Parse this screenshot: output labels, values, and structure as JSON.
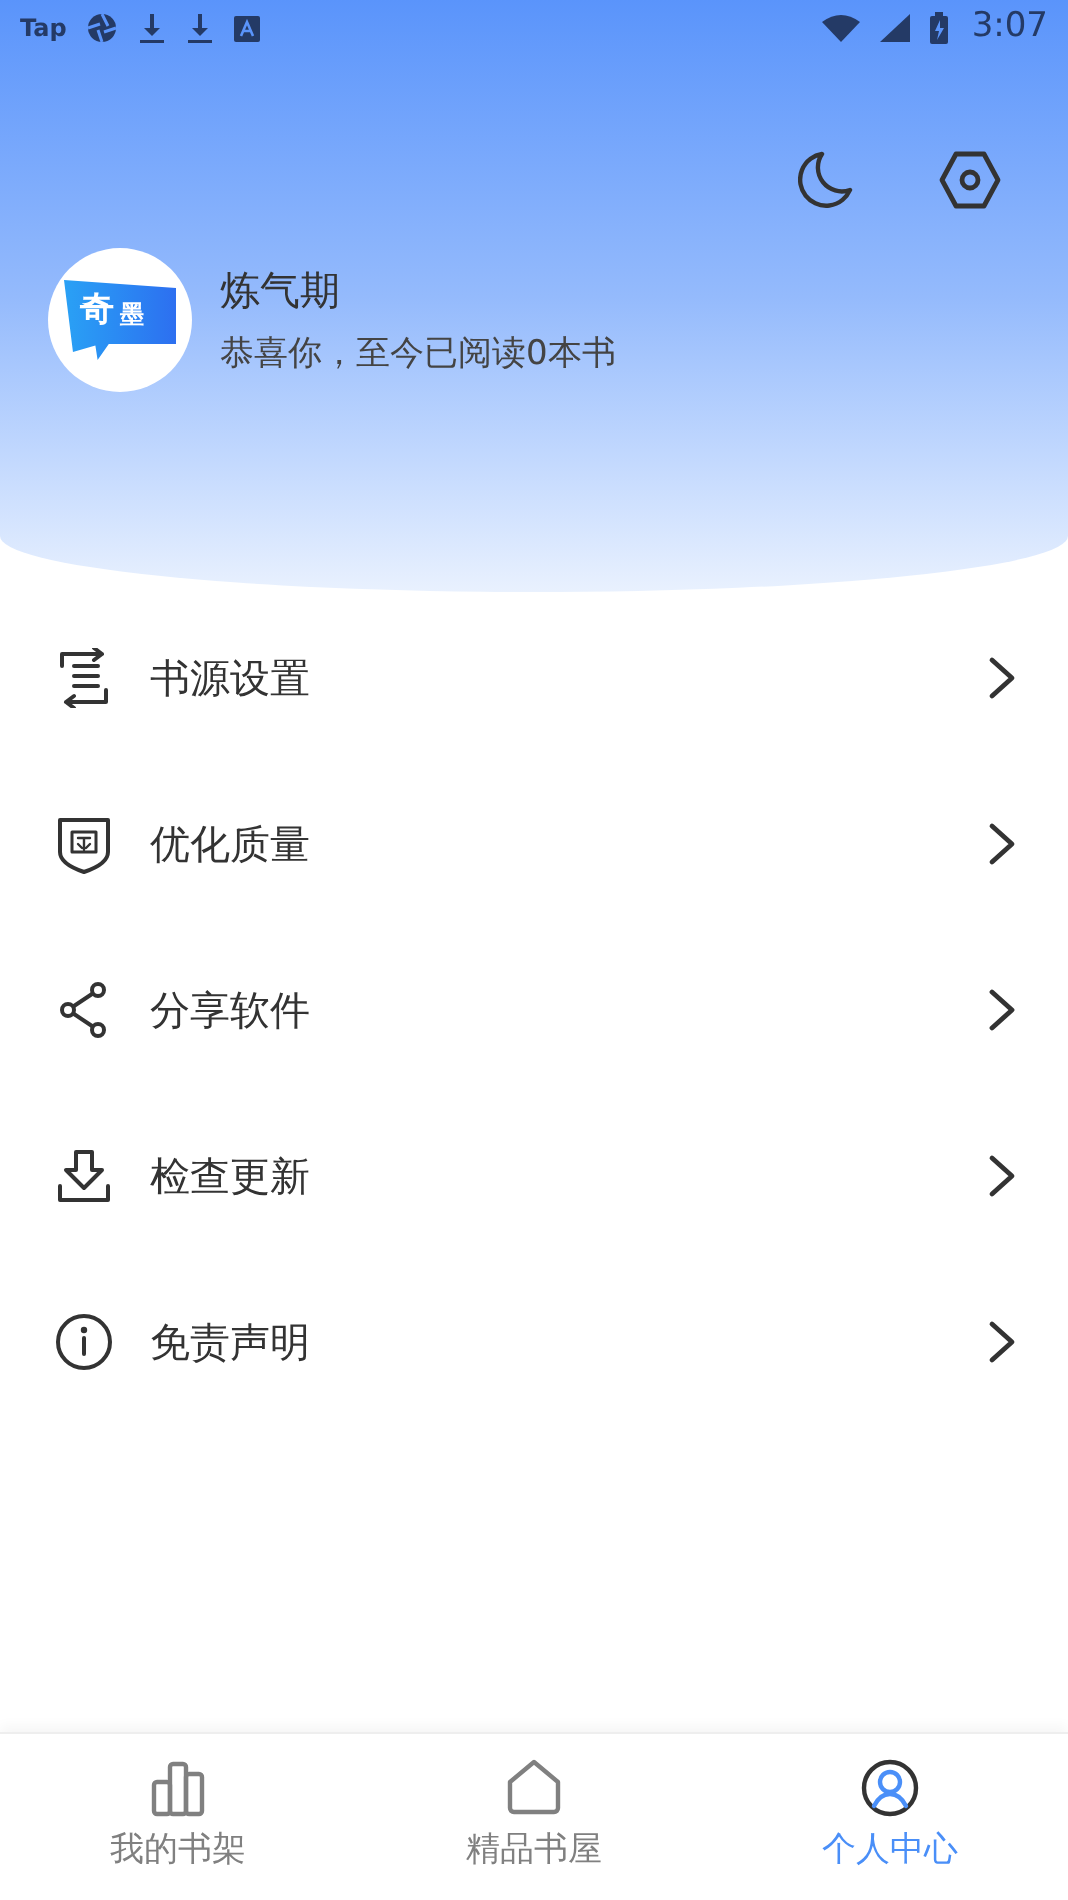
{
  "status_bar": {
    "app_label": "Tap",
    "time": "3:07"
  },
  "profile": {
    "logo_text": [
      "奇",
      "墨"
    ],
    "name": "炼气期",
    "subtitle": "恭喜你，至今已阅读0本书"
  },
  "menu": [
    {
      "kind": "source",
      "label": "书源设置"
    },
    {
      "kind": "quality",
      "label": "优化质量"
    },
    {
      "kind": "share",
      "label": "分享软件"
    },
    {
      "kind": "update",
      "label": "检查更新"
    },
    {
      "kind": "info",
      "label": "免责声明"
    }
  ],
  "nav": [
    {
      "kind": "shelf",
      "label": "我的书架",
      "selected": false
    },
    {
      "kind": "store",
      "label": "精品书屋",
      "selected": false
    },
    {
      "kind": "me",
      "label": "个人中心",
      "selected": true
    }
  ]
}
